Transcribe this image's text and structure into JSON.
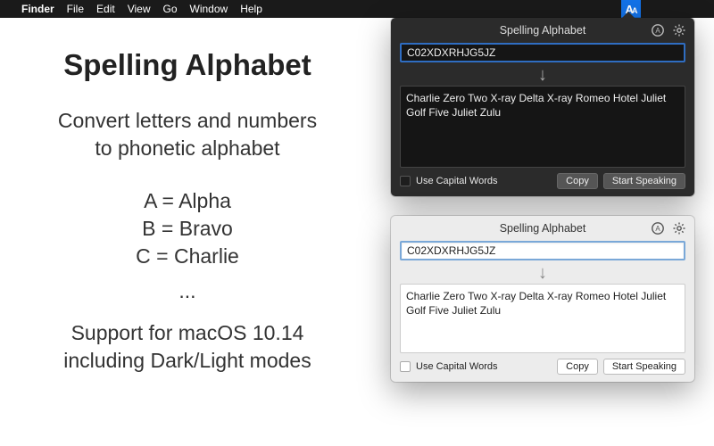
{
  "menubar": {
    "app": "Finder",
    "items": [
      "File",
      "Edit",
      "View",
      "Go",
      "Window",
      "Help"
    ],
    "status_icon_label": "AA"
  },
  "promo": {
    "title": "Spelling Alphabet",
    "subtitle_l1": "Convert letters and numbers",
    "subtitle_l2": "to phonetic alphabet",
    "example_a": "A = Alpha",
    "example_b": "B = Bravo",
    "example_c": "C = Charlie",
    "ellipsis": "...",
    "footer_l1": "Support for macOS 10.14",
    "footer_l2": "including Dark/Light modes"
  },
  "panel": {
    "title": "Spelling Alphabet",
    "input_value": "C02XDXRHJG5JZ",
    "output_text": "Charlie Zero Two X-ray Delta X-ray Romeo Hotel Juliet Golf Five Juliet Zulu",
    "use_capital_label": "Use Capital Words",
    "copy_label": "Copy",
    "speak_label": "Start Speaking"
  }
}
